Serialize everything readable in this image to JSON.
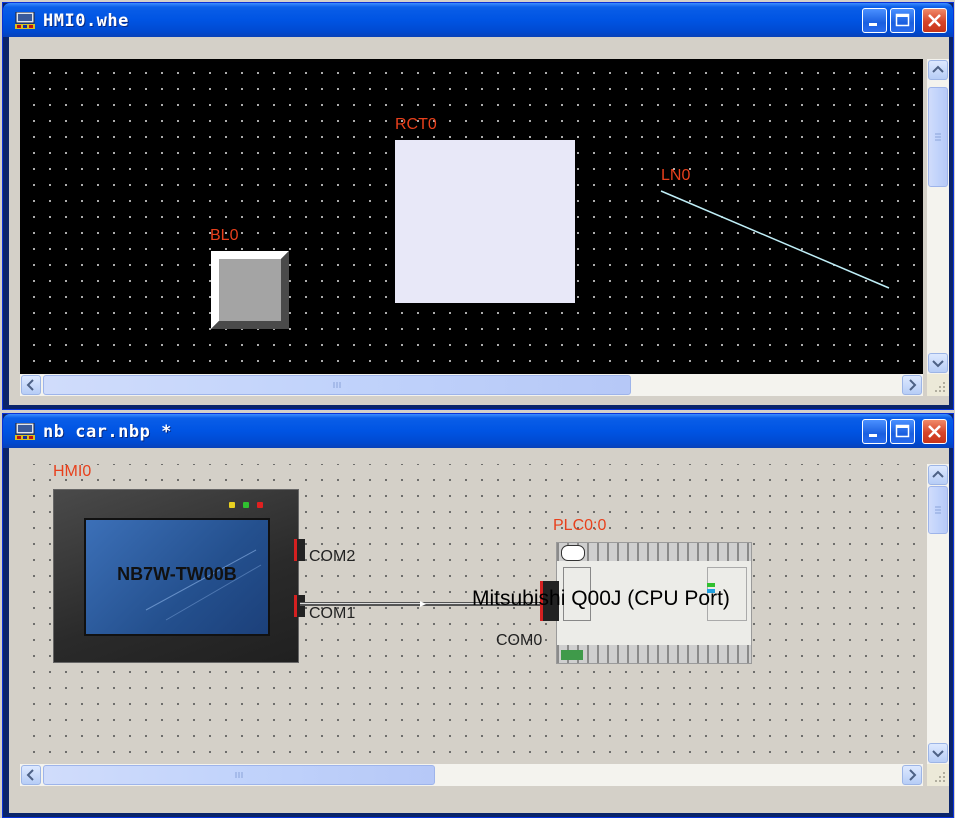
{
  "windows": [
    {
      "title": "HMI0.whe",
      "canvas": {
        "background": "#000000",
        "objects": {
          "rect_label": "RCT0",
          "line_label": "LN0",
          "button_label": "BL0"
        }
      }
    },
    {
      "title": "nb car.nbp *",
      "canvas": {
        "background": "#d4d0c8",
        "hmi": {
          "label": "HMI0",
          "model": "NB7W-TW00B",
          "ports": [
            "COM2",
            "COM1"
          ]
        },
        "plc": {
          "label": "PLC0:0",
          "model": "Mitsubishi Q00J (CPU Port)",
          "port": "COM0"
        }
      }
    }
  ],
  "colors": {
    "title_bar": "#0054e3",
    "label_red": "#e8401c",
    "line_cyan": "#bfeef7",
    "rect_fill": "#e8e8f8"
  },
  "icons": [
    "nbd-app-icon",
    "minimize-icon",
    "maximize-icon",
    "close-icon",
    "scroll-up-icon",
    "scroll-down-icon",
    "scroll-left-icon",
    "scroll-right-icon",
    "resize-grip-icon"
  ]
}
